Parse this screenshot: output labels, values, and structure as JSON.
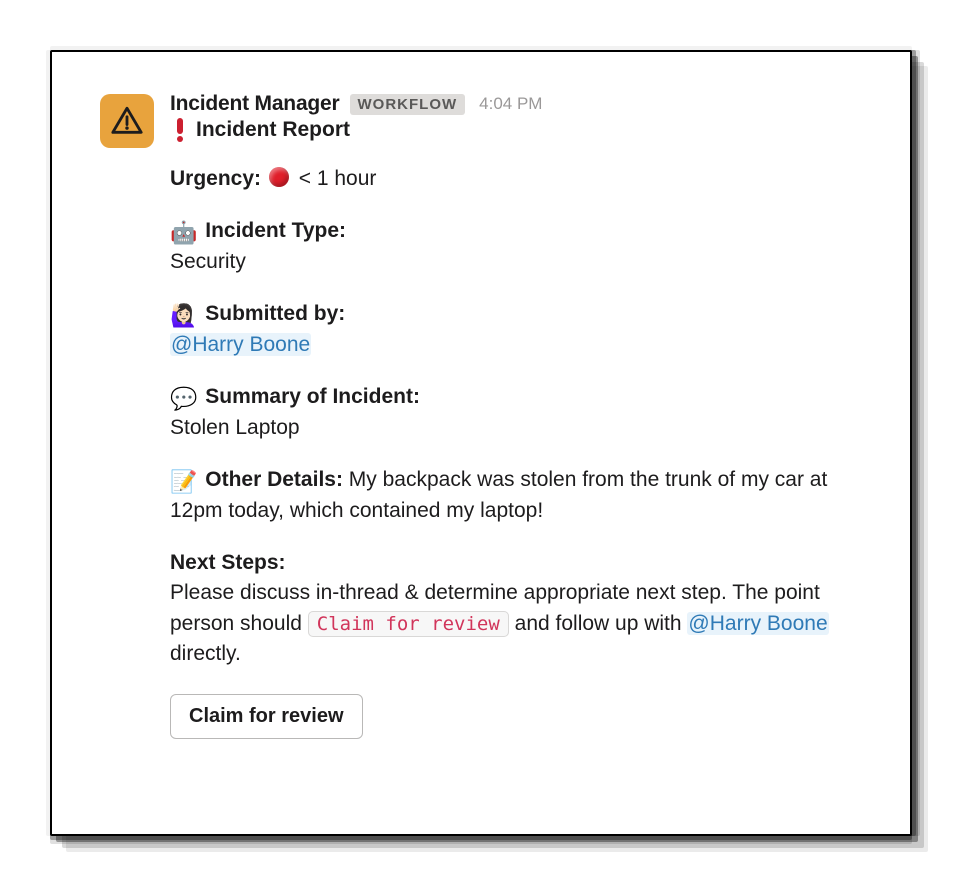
{
  "sender": {
    "name": "Incident Manager",
    "badge": "WORKFLOW",
    "timestamp": "4:04 PM"
  },
  "title": {
    "icon": "exclamation-mark",
    "text": "Incident Report"
  },
  "sections": {
    "urgency": {
      "label": "Urgency:",
      "icon": "red-circle",
      "value": "< 1 hour"
    },
    "incident_type": {
      "icon": "🤖",
      "label": "Incident Type:",
      "value": "Security"
    },
    "submitted_by": {
      "icon": "🙋🏻‍♀️",
      "label": "Submitted by:",
      "mention": "@Harry Boone"
    },
    "summary": {
      "icon": "💬",
      "label": "Summary of Incident:",
      "value": "Stolen Laptop"
    },
    "other_details": {
      "icon": "📝",
      "label": "Other Details:",
      "value": "My backpack was stolen from the trunk of my car at 12pm today, which contained my laptop!"
    },
    "next_steps": {
      "label": "Next Steps:",
      "text_before": "Please discuss in-thread & determine appropriate next step. The point person should ",
      "code": "Claim for review",
      "text_mid": " and follow up with ",
      "mention": "@Harry Boone",
      "text_after": " directly."
    }
  },
  "action_button": {
    "label": "Claim for review"
  }
}
